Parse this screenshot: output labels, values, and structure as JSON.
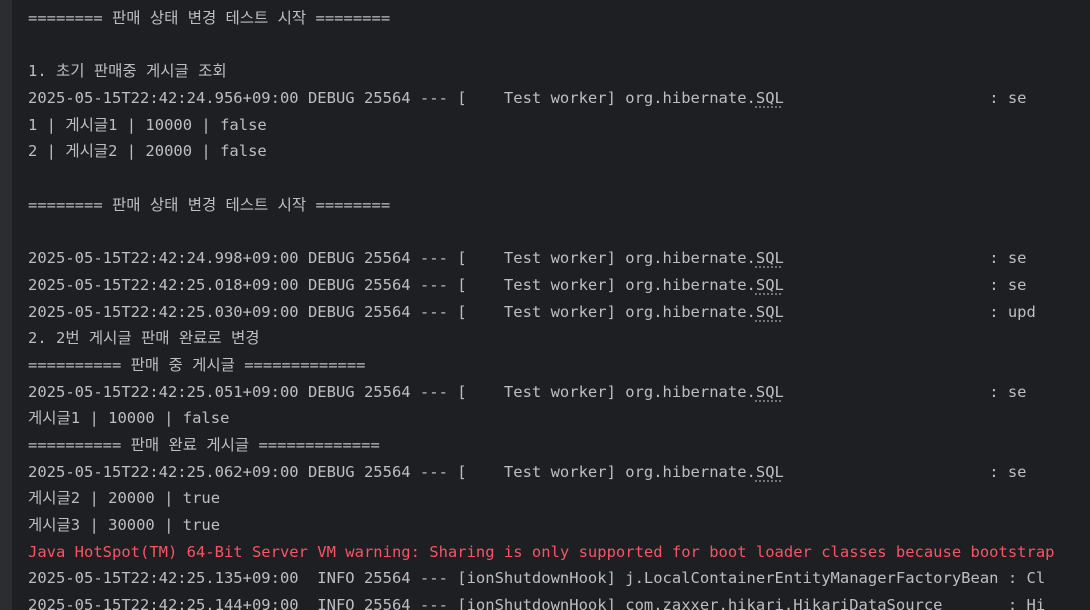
{
  "console": {
    "lines": [
      {
        "kind": "plain",
        "text": "======== 판매 상태 변경 테스트 시작 ========"
      },
      {
        "kind": "plain",
        "text": ""
      },
      {
        "kind": "plain",
        "text": "1. 초기 판매중 게시글 조회"
      },
      {
        "kind": "log",
        "prefix": "2025-05-15T22:42:24.956+09:00 DEBUG 25564 --- [    Test worker] org.hibernate.",
        "link": "SQL",
        "suffix": "                      : se"
      },
      {
        "kind": "plain",
        "text": "1 | 게시글1 | 10000 | false"
      },
      {
        "kind": "plain",
        "text": "2 | 게시글2 | 20000 | false"
      },
      {
        "kind": "plain",
        "text": ""
      },
      {
        "kind": "plain",
        "text": "======== 판매 상태 변경 테스트 시작 ========"
      },
      {
        "kind": "plain",
        "text": ""
      },
      {
        "kind": "log",
        "prefix": "2025-05-15T22:42:24.998+09:00 DEBUG 25564 --- [    Test worker] org.hibernate.",
        "link": "SQL",
        "suffix": "                      : se"
      },
      {
        "kind": "log",
        "prefix": "2025-05-15T22:42:25.018+09:00 DEBUG 25564 --- [    Test worker] org.hibernate.",
        "link": "SQL",
        "suffix": "                      : se"
      },
      {
        "kind": "log",
        "prefix": "2025-05-15T22:42:25.030+09:00 DEBUG 25564 --- [    Test worker] org.hibernate.",
        "link": "SQL",
        "suffix": "                      : upd"
      },
      {
        "kind": "plain",
        "text": "2. 2번 게시글 판매 완료로 변경"
      },
      {
        "kind": "plain",
        "text": "========== 판매 중 게시글 ============="
      },
      {
        "kind": "log",
        "prefix": "2025-05-15T22:42:25.051+09:00 DEBUG 25564 --- [    Test worker] org.hibernate.",
        "link": "SQL",
        "suffix": "                      : se"
      },
      {
        "kind": "plain",
        "text": "게시글1 | 10000 | false"
      },
      {
        "kind": "plain",
        "text": "========== 판매 완료 게시글 ============="
      },
      {
        "kind": "log",
        "prefix": "2025-05-15T22:42:25.062+09:00 DEBUG 25564 --- [    Test worker] org.hibernate.",
        "link": "SQL",
        "suffix": "                      : se"
      },
      {
        "kind": "plain",
        "text": "게시글2 | 20000 | true"
      },
      {
        "kind": "plain",
        "text": "게시글3 | 30000 | true"
      },
      {
        "kind": "warn",
        "text": "Java HotSpot(TM) 64-Bit Server VM warning: Sharing is only supported for boot loader classes because bootstrap"
      },
      {
        "kind": "plain",
        "text": "2025-05-15T22:42:25.135+09:00  INFO 25564 --- [ionShutdownHook] j.LocalContainerEntityManagerFactoryBean : Cl"
      },
      {
        "kind": "plain",
        "text": "2025-05-15T22:42:25.144+09:00  INFO 25564 --- [ionShutdownHook] com.zaxxer.hikari.HikariDataSource       : Hi"
      }
    ]
  },
  "colors": {
    "background": "#1e1f22",
    "text": "#bcbec4",
    "warning": "#f75464"
  }
}
